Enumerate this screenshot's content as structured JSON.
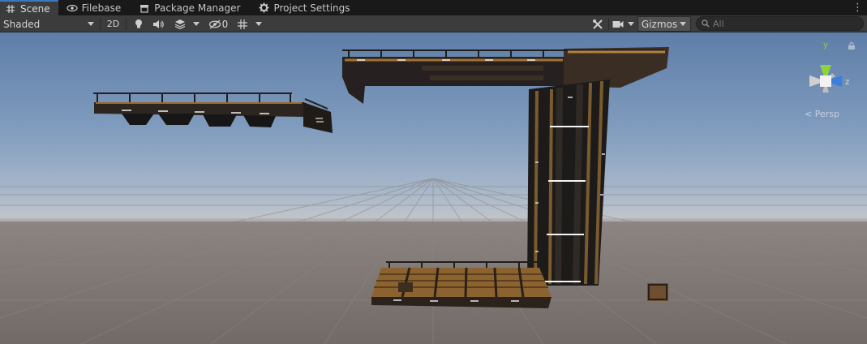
{
  "tabs": [
    {
      "label": "Scene",
      "icon": "grid-icon",
      "active": true
    },
    {
      "label": "Filebase",
      "icon": "eye-icon",
      "active": false
    },
    {
      "label": "Package Manager",
      "icon": "package-icon",
      "active": false
    },
    {
      "label": "Project Settings",
      "icon": "gear-icon",
      "active": false
    }
  ],
  "toolbar": {
    "shading_mode": "Shaded",
    "mode_2d": "2D",
    "hidden_count": "0",
    "gizmos_label": "Gizmos",
    "search_placeholder": "All"
  },
  "scene_gizmo": {
    "axis_y": "y",
    "axis_z": "z",
    "projection_label": "Persp"
  },
  "colors": {
    "tab_active_accent": "#3a79bb",
    "axis_y": "#8fd33b",
    "axis_z": "#3a7ee0",
    "axis_x": "#cccccc"
  }
}
